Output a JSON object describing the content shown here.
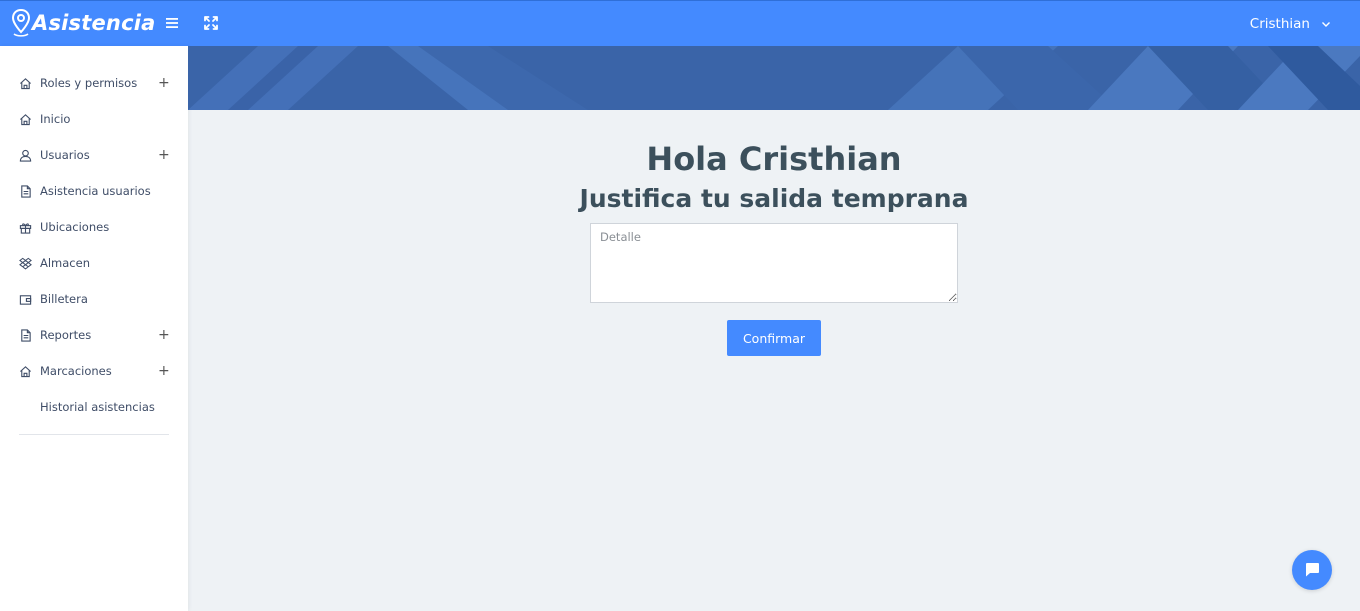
{
  "app": {
    "brand": "Asistencia",
    "brand_color": "#448aff"
  },
  "header": {
    "menu_icon": "hamburger-icon",
    "fullscreen_icon": "expand-icon",
    "user_name": "Cristhian"
  },
  "sidebar": {
    "items": [
      {
        "label": "Roles y permisos",
        "icon": "home-icon",
        "expandable": true
      },
      {
        "label": "Inicio",
        "icon": "home-icon",
        "expandable": false
      },
      {
        "label": "Usuarios",
        "icon": "user-icon",
        "expandable": true
      },
      {
        "label": "Asistencia usuarios",
        "icon": "file-text-icon",
        "expandable": false
      },
      {
        "label": "Ubicaciones",
        "icon": "gift-icon",
        "expandable": false
      },
      {
        "label": "Almacen",
        "icon": "dropbox-icon",
        "expandable": false
      },
      {
        "label": "Billetera",
        "icon": "wallet-icon",
        "expandable": false
      },
      {
        "label": "Reportes",
        "icon": "file-text-icon",
        "expandable": true
      },
      {
        "label": "Marcaciones",
        "icon": "home-icon",
        "expandable": true
      },
      {
        "label": "Historial asistencias",
        "icon": "",
        "expandable": false
      }
    ],
    "expand_symbol": "+"
  },
  "main": {
    "greeting": "Hola Cristhian",
    "subtitle": "Justifica tu salida temprana",
    "detail_placeholder": "Detalle",
    "detail_value": "",
    "confirm_label": "Confirmar"
  },
  "chat": {
    "icon": "chat-icon"
  }
}
